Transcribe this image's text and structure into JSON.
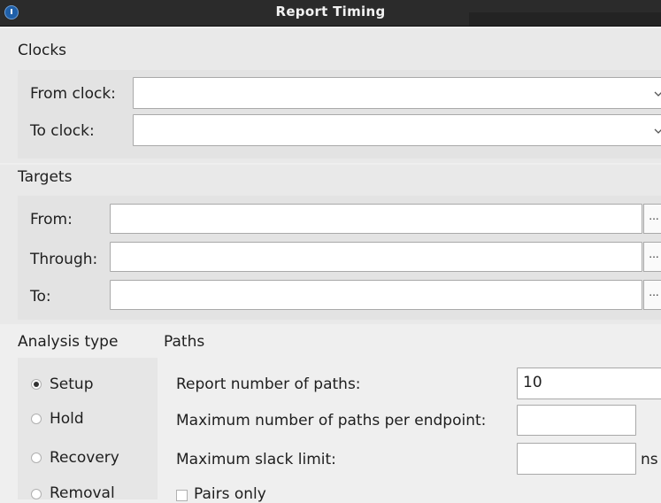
{
  "window": {
    "title": "Report Timing"
  },
  "clocks": {
    "header": "Clocks",
    "from_label": "From clock:",
    "from_value": "",
    "to_label": "To clock:",
    "to_value": ""
  },
  "targets": {
    "header": "Targets",
    "from_label": "From:",
    "through_label": "Through:",
    "to_label": "To:",
    "browse_label": "..."
  },
  "analysis": {
    "header": "Analysis type",
    "options": [
      "Setup",
      "Hold",
      "Recovery",
      "Removal"
    ],
    "selected": "Setup"
  },
  "paths": {
    "header": "Paths",
    "report_number_label": "Report number of paths:",
    "report_number_value": "10",
    "max_per_endpoint_label": "Maximum number of paths per endpoint:",
    "max_per_endpoint_value": "",
    "max_slack_label": "Maximum slack limit:",
    "max_slack_value": "",
    "max_slack_unit": "ns",
    "pairs_only_label": "Pairs only",
    "pairs_only_checked": false
  }
}
